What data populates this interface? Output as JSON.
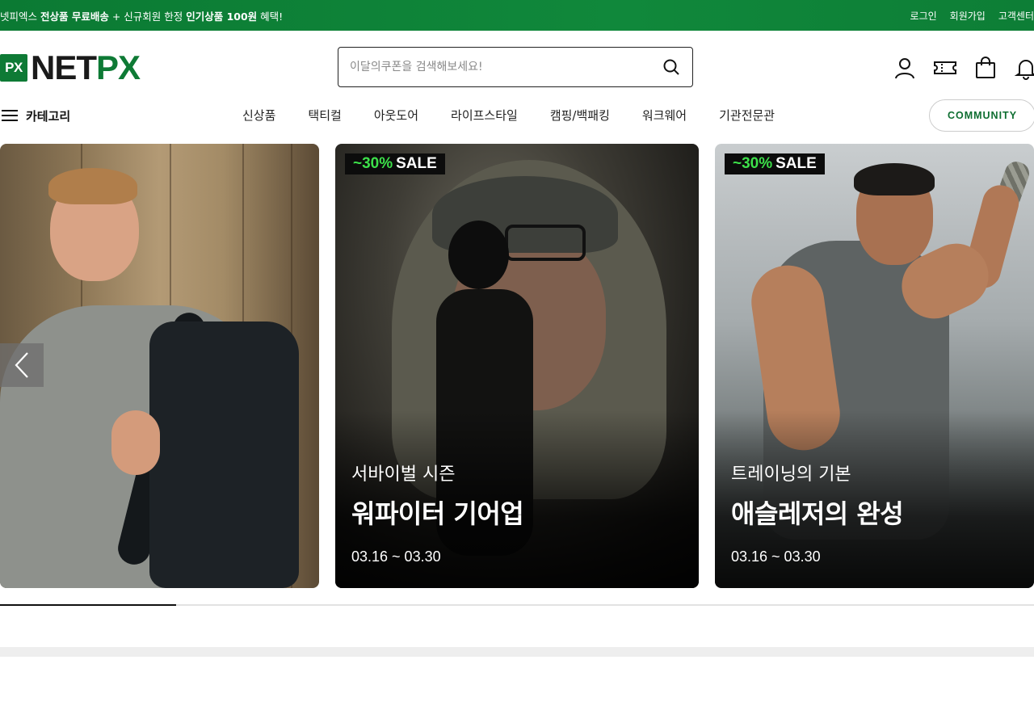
{
  "promo": {
    "part1": "넷피엑스 ",
    "bold1": "전상품 무료배송",
    "part2": " + 신규회원 한정 ",
    "bold2": "인기상품 100원",
    "part3": " 혜택!",
    "links": [
      "로그인",
      "회원가입",
      "고객센터"
    ]
  },
  "header": {
    "logo_badge": "PX",
    "logo_net": "NET",
    "logo_px": "PX",
    "search_placeholder": "이달의쿠폰을 검색해보세요!",
    "icons": [
      "user-icon",
      "coupon-icon",
      "shopping-bag-icon",
      "bell-icon"
    ]
  },
  "nav": {
    "category_label": "카테고리",
    "items": [
      "신상품",
      "택티컬",
      "아웃도어",
      "라이프스타일",
      "캠핑/백패킹",
      "워크웨어",
      "기관전문관"
    ],
    "community_label": "COMMUNITY"
  },
  "slides": [
    {},
    {
      "badge_pct": "~30%",
      "badge_word": "SALE",
      "subtitle": "서바이벌 시즌",
      "title": "워파이터 기어업",
      "date": "03.16 ~ 03.30"
    },
    {
      "badge_pct": "~30%",
      "badge_word": "SALE",
      "subtitle": "트레이닝의 기본",
      "title": "애슬레저의 완성",
      "date": "03.16 ~ 03.30"
    }
  ],
  "carousel": {
    "progress": 0.17
  },
  "colors": {
    "brand_green": "#0e7a35",
    "sale_green": "#3de04a"
  }
}
